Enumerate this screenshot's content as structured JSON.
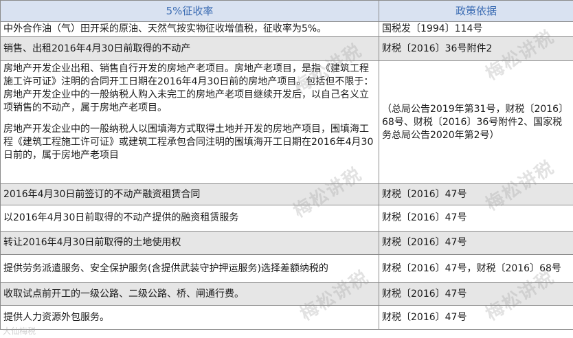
{
  "table": {
    "headers": [
      "5%征收率",
      "政策依据"
    ],
    "rows": [
      {
        "item": "中外合作油（气）田开采的原油、天然气按实物征收增值税，征收率为5%。",
        "basis": "国税发〔1994〕114号"
      },
      {
        "item": "销售、出租2016年4月30日前取得的不动产",
        "basis": "财税〔2016〕36号附件2"
      },
      {
        "item_p1": "房地产开发企业出租、销售自行开发的房地产老项目。房地产老项目，是指《建筑工程施工许可证》注明的合同开工日期在2016年4月30日前的房地产项目。包括但不限于：房地产开发企业中的一般纳税人购入未完工的房地产老项目继续开发后，以自己名义立项销售的不动产，属于房地产老项目。",
        "item_p2": "房地产开发企业中的一般纳税人以围填海方式取得土地并开发的房地产项目，围填海工程《建筑工程施工许可证》或建筑工程承包合同注明的围填海开工日期在2016年4月30日前的，属于房地产老项目",
        "basis": "（总局公告2019年第31号，财税〔2016〕68号、财税〔2016〕36号附件2、国家税务总局公告2020年第2号）"
      },
      {
        "item": "2016年4月30日前签订的不动产融资租赁合同",
        "basis": "财税〔2016〕47号"
      },
      {
        "item": "以2016年4月30日前取得的不动产提供的融资租赁服务",
        "basis": "财税〔2016〕47号"
      },
      {
        "item": "转让2016年4月30日前取得的土地使用权",
        "basis": "财税〔2016〕47号"
      },
      {
        "item": "提供劳务派遣服务、安全保护服务(含提供武装守护押运服务)选择差额纳税的",
        "basis": "财税〔2016〕47号，财税〔2016〕68号"
      },
      {
        "item": "收取试点前开工的一级公路、二级公路、桥、闸通行费。",
        "basis": "财税〔2016〕47号"
      },
      {
        "item": "提供人力资源外包服务。",
        "basis": "财税〔2016〕47号"
      }
    ]
  },
  "watermark": "梅松讲税",
  "corner_watermark": "大仙梅税"
}
